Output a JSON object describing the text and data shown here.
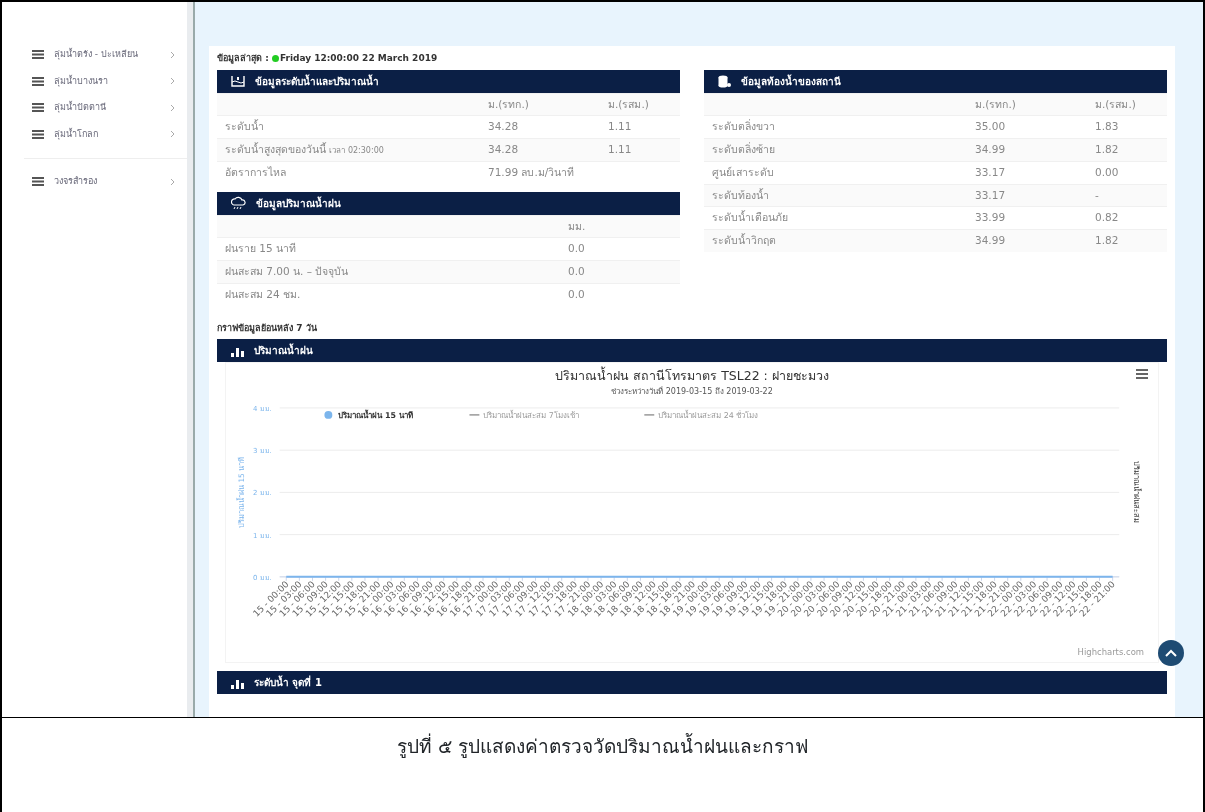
{
  "sidebar": {
    "groups": [
      {
        "items": [
          {
            "label": "ลุ่มน้ำตรัง - ปะเหลียน"
          },
          {
            "label": "ลุ่มน้ำบางนรา"
          },
          {
            "label": "ลุ่มน้ำปัตตานี"
          },
          {
            "label": "ลุ่มน้ำโกลก"
          }
        ]
      },
      {
        "items": [
          {
            "label": "วงจรสำรอง"
          }
        ]
      }
    ]
  },
  "latest": {
    "label": "ข้อมูลล่าสุด :",
    "time": "Friday 12:00:00 22 March 2019",
    "online": true
  },
  "water_panel": {
    "title": "ข้อมูลระดับน้ำและปริมาณน้ำ",
    "columns": [
      "ม.(รทก.)",
      "ม.(รสม.)"
    ],
    "rows": [
      {
        "label": "ระดับน้ำ",
        "cells": [
          "34.28",
          "1.11"
        ]
      },
      {
        "label": "ระดับน้ำสูงสุดของวันนี้",
        "note": "เวลา 02:30:00",
        "cells": [
          "34.28",
          "1.11"
        ]
      },
      {
        "label": "อัตราการไหล",
        "cells": [
          "71.99 ลบ.ม/วินาที"
        ]
      }
    ]
  },
  "rain_panel": {
    "title": "ข้อมูลปริมาณน้ำฝน",
    "columns": [
      "มม."
    ],
    "rows": [
      {
        "label": "ฝนราย 15 นาที",
        "cells": [
          "0.0"
        ]
      },
      {
        "label": "ฝนสะสม 7.00 น. – ปัจจุบัน",
        "cells": [
          "0.0"
        ]
      },
      {
        "label": "ฝนสะสม 24 ชม.",
        "cells": [
          "0.0"
        ]
      }
    ]
  },
  "bed_panel": {
    "title": "ข้อมูลท้องน้ำของสถานี",
    "columns": [
      "ม.(รทก.)",
      "ม.(รสม.)"
    ],
    "rows": [
      {
        "label": "ระดับตลิ่งขวา",
        "cells": [
          "35.00",
          "1.83"
        ]
      },
      {
        "label": "ระดับตลิ่งซ้าย",
        "cells": [
          "34.99",
          "1.82"
        ]
      },
      {
        "label": "ศูนย์เสาระดับ",
        "cells": [
          "33.17",
          "0.00"
        ]
      },
      {
        "label": "ระดับท้องน้ำ",
        "cells": [
          "33.17",
          "-"
        ]
      },
      {
        "label": "ระดับน้ำเตือนภัย",
        "cells": [
          "33.99",
          "0.82"
        ]
      },
      {
        "label": "ระดับน้ำวิกฤต",
        "cells": [
          "34.99",
          "1.82"
        ]
      }
    ]
  },
  "history_heading": "กราฟข้อมูลย้อนหลัง 7 วัน",
  "rain_chart": {
    "header": "ปริมาณน้ำฝน",
    "subtitle": "ช่วงระหว่างวันที่ 2019-03-15 ถึง 2019-03-22",
    "right_axis_title": "ปริมาณน้ำฝนสะสม",
    "credit": "Highcharts.com",
    "hidden_series": [
      {
        "label": "ปริมาณน้ำฝนสะสม 7โมงเช้า"
      },
      {
        "label": "ปริมาณน้ำฝนสะสม 24 ชั่วโมง"
      }
    ],
    "chart_data": {
      "type": "line",
      "title": "ปริมาณน้ำฝน สถานีโทรมาตร TSL22 : ฝายชะมวง",
      "ylabel": "ปริมาณน้ำฝน 15 นาที",
      "ylim": [
        0,
        4
      ],
      "grid": true,
      "yticks": [
        {
          "value": 0,
          "label": "0 มม."
        },
        {
          "value": 1,
          "label": "1 มม."
        },
        {
          "value": 2,
          "label": "2 มม."
        },
        {
          "value": 3,
          "label": "3 มม."
        },
        {
          "value": 4,
          "label": "4 มม."
        }
      ],
      "categories": [
        "15 - 00:00",
        "15 - 03:00",
        "15 - 06:00",
        "15 - 09:00",
        "15 - 12:00",
        "15 - 15:00",
        "15 - 18:00",
        "15 - 21:00",
        "16 - 00:00",
        "16 - 03:00",
        "16 - 06:00",
        "16 - 09:00",
        "16 - 12:00",
        "16 - 15:00",
        "16 - 18:00",
        "16 - 21:00",
        "17 - 00:00",
        "17 - 03:00",
        "17 - 06:00",
        "17 - 09:00",
        "17 - 12:00",
        "17 - 15:00",
        "17 - 18:00",
        "17 - 21:00",
        "18 - 00:00",
        "18 - 03:00",
        "18 - 06:00",
        "18 - 09:00",
        "18 - 12:00",
        "18 - 15:00",
        "18 - 18:00",
        "18 - 21:00",
        "19 - 00:00",
        "19 - 03:00",
        "19 - 06:00",
        "19 - 09:00",
        "19 - 12:00",
        "19 - 15:00",
        "19 - 18:00",
        "19 - 21:00",
        "20 - 00:00",
        "20 - 03:00",
        "20 - 06:00",
        "20 - 09:00",
        "20 - 12:00",
        "20 - 15:00",
        "20 - 18:00",
        "20 - 21:00",
        "21 - 00:00",
        "21 - 03:00",
        "21 - 06:00",
        "21 - 09:00",
        "21 - 12:00",
        "21 - 15:00",
        "21 - 18:00",
        "21 - 21:00",
        "22 - 00:00",
        "22 - 03:00",
        "22 - 06:00",
        "22 - 09:00",
        "22 - 12:00",
        "22 - 15:00",
        "22 - 18:00",
        "22 - 21:00"
      ],
      "series": [
        {
          "name": "ปริมาณน้ำฝน 15 นาที",
          "color": "#7cb5ec",
          "values": [
            0,
            0,
            0,
            0,
            0,
            0,
            0,
            0,
            0,
            0,
            0,
            0,
            0,
            0,
            0,
            0,
            0,
            0,
            0,
            0,
            0,
            0,
            0,
            0,
            0,
            0,
            0,
            0,
            0,
            0,
            0,
            0,
            0,
            0,
            0,
            0,
            0,
            0,
            0,
            0,
            0,
            0,
            0,
            0,
            0,
            0,
            0,
            0,
            0,
            0,
            0,
            0,
            0,
            0,
            0,
            0,
            0,
            0,
            0,
            0,
            0,
            0,
            0,
            0
          ]
        }
      ]
    }
  },
  "next_header": "ระดับน้ำ จุดที่ 1",
  "caption": "รูปที่ ๕ รูปแสดงค่าตรวจวัดปริมาณน้ำฝนและกราฟ"
}
